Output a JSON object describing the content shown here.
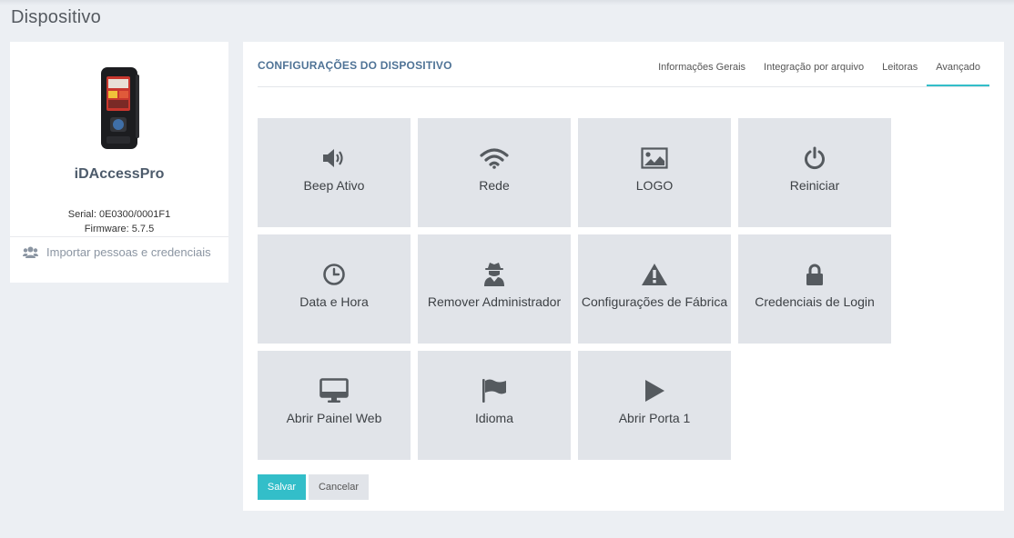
{
  "page": {
    "title": "Dispositivo"
  },
  "device": {
    "name": "iDAccessPro",
    "serial": "Serial: 0E0300/0001F1",
    "firmware": "Firmware: 5.7.5",
    "import_label": "Importar pessoas e credenciais"
  },
  "panel": {
    "title": "CONFIGURAÇÕES DO DISPOSITIVO",
    "tabs": [
      {
        "label": "Informações Gerais",
        "active": false
      },
      {
        "label": "Integração por arquivo",
        "active": false
      },
      {
        "label": "Leitoras",
        "active": false
      },
      {
        "label": "Avançado",
        "active": true
      }
    ],
    "tiles": [
      {
        "label": "Beep Ativo",
        "icon": "volume-icon"
      },
      {
        "label": "Rede",
        "icon": "wifi-icon"
      },
      {
        "label": "LOGO",
        "icon": "image-icon"
      },
      {
        "label": "Reiniciar",
        "icon": "power-icon"
      },
      {
        "label": "Data e Hora",
        "icon": "clock-icon"
      },
      {
        "label": "Remover Administrador",
        "icon": "user-secret-icon"
      },
      {
        "label": "Configurações de Fábrica",
        "icon": "warning-icon"
      },
      {
        "label": "Credenciais de Login",
        "icon": "lock-icon"
      },
      {
        "label": "Abrir Painel Web",
        "icon": "monitor-icon"
      },
      {
        "label": "Idioma",
        "icon": "flag-icon"
      },
      {
        "label": "Abrir Porta 1",
        "icon": "play-icon"
      }
    ],
    "save_label": "Salvar",
    "cancel_label": "Cancelar"
  },
  "colors": {
    "accent": "#33bec9",
    "tile_bg": "#e1e4e9",
    "title_blue": "#4f7396"
  }
}
